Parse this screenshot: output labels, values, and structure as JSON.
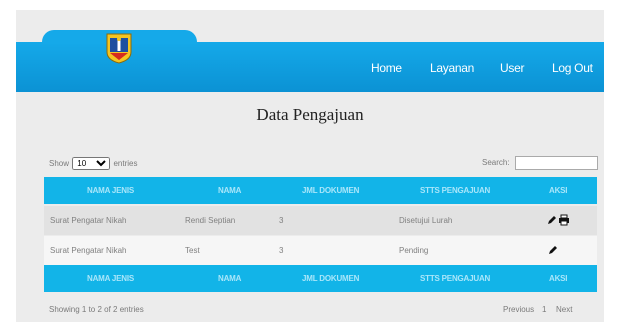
{
  "header": {
    "nav": [
      "Home",
      "Layanan",
      "User",
      "Log Out"
    ]
  },
  "page_title": "Data Pengajuan",
  "controls": {
    "show_prefix": "Show",
    "entries_value": "10",
    "show_suffix": "entries",
    "search_label": "Search:"
  },
  "table": {
    "columns": [
      "NAMA JENIS",
      "NAMA",
      "JML DOKUMEN",
      "STTS PENGAJUAN",
      "AKSI"
    ],
    "rows": [
      {
        "jenis": "Surat Pengatar Nikah",
        "nama": "Rendi Septian",
        "jml": "3",
        "status": "Disetujui Lurah"
      },
      {
        "jenis": "Surat Pengatar Nikah",
        "nama": "Test",
        "jml": "3",
        "status": "Pending"
      }
    ]
  },
  "footer": {
    "info": "Showing 1 to 2 of 2 entries",
    "previous": "Previous",
    "page": "1",
    "next": "Next"
  },
  "colors": {
    "header": "#15a9e9",
    "table_header": "#12b4e8"
  },
  "icons": {
    "edit": "pencil-icon",
    "print": "printer-icon"
  }
}
